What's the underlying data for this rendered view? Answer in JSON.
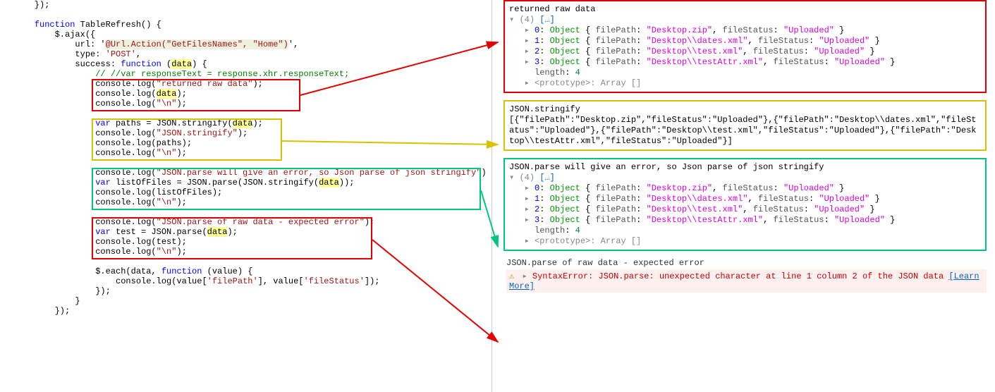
{
  "left": {
    "l01": "    });",
    "l02": "",
    "l03_a": "    ",
    "l03_fn": "function",
    "l03_b": " TableRefresh() {",
    "l04": "        $.ajax({",
    "l05_a": "            url: '",
    "l05_url": "@Url.Action(\"GetFilesNames\", \"Home\")",
    "l05_b": "',",
    "l06_a": "            type: ",
    "l06_post": "'POST'",
    "l06_b": ",",
    "l07_a": "            success: ",
    "l07_fn": "function",
    "l07_b": " (",
    "l07_data": "data",
    "l07_c": ") {",
    "l08": "                // //var responseText = response.xhr.responseText;",
    "l09_a": "                console.log(",
    "l09_s": "\"returned raw data\"",
    "l09_b": ");",
    "l10_a": "                console.log(",
    "l10_d": "data",
    "l10_b": ");",
    "l11_a": "                console.log(",
    "l11_s": "\"\\n\"",
    "l11_b": ");",
    "l12": "",
    "l13_a": "                ",
    "l13_var": "var",
    "l13_b": " paths = JSON.stringify(",
    "l13_d": "data",
    "l13_c": ");",
    "l14_a": "                console.log(",
    "l14_s": "\"JSON.stringify\"",
    "l14_b": ");",
    "l15": "                console.log(paths);",
    "l16_a": "                console.log(",
    "l16_s": "\"\\n\"",
    "l16_b": ");",
    "l17": "",
    "l18_a": "                console.log(",
    "l18_s": "\"JSON.parse will give an error, so Json parse of json stringify\"",
    "l18_b": ")",
    "l19_a": "                ",
    "l19_var": "var",
    "l19_b": " listOfFiles = JSON.parse(JSON.stringify(",
    "l19_d": "data",
    "l19_c": "));",
    "l20": "                console.log(listOfFiles);",
    "l21_a": "                console.log(",
    "l21_s": "\"\\n\"",
    "l21_b": ");",
    "l22": "",
    "l23_a": "                console.log(",
    "l23_s": "\"JSON.parse of raw data - expected error\"",
    "l23_b": ");",
    "l24_a": "                ",
    "l24_var": "var",
    "l24_b": " test = JSON.parse(",
    "l24_d": "data",
    "l24_c": ");",
    "l25": "                console.log(test);",
    "l26_a": "                console.log(",
    "l26_s": "\"\\n\"",
    "l26_b": ");",
    "l27": "",
    "l28_a": "                $.each(data, ",
    "l28_fn": "function",
    "l28_b": " (value) {",
    "l29_a": "                    console.log(value[",
    "l29_s1": "'filePath'",
    "l29_b": "], value[",
    "l29_s2": "'fileStatus'",
    "l29_c": "]);",
    "l30": "                });",
    "l31": "            }",
    "l32": "        });"
  },
  "right": {
    "p1_title": "returned raw data",
    "arr_count": "(4)",
    "arr_ellipsis": "[…]",
    "item0_idx": "0",
    "item0_obj": "Object",
    "item0_fp": "filePath",
    "item0_fpv": "\"Desktop.zip\"",
    "item0_fs": "fileStatus",
    "item0_fsv": "\"Uploaded\"",
    "item1_idx": "1",
    "item1_obj": "Object",
    "item1_fp": "filePath",
    "item1_fpv": "\"Desktop\\\\dates.xml\"",
    "item1_fs": "fileStatus",
    "item1_fsv": "\"Uploaded\"",
    "item2_idx": "2",
    "item2_obj": "Object",
    "item2_fp": "filePath",
    "item2_fpv": "\"Desktop\\\\test.xml\"",
    "item2_fs": "fileStatus",
    "item2_fsv": "\"Uploaded\"",
    "item3_idx": "3",
    "item3_obj": "Object",
    "item3_fp": "filePath",
    "item3_fpv": "\"Desktop\\\\testAttr.xml\"",
    "item3_fs": "fileStatus",
    "item3_fsv": "\"Uploaded\"",
    "length_label": "length",
    "length_val": "4",
    "proto": "<prototype>: Array []",
    "p2_title": "JSON.stringify",
    "p2_body": "[{\"filePath\":\"Desktop.zip\",\"fileStatus\":\"Uploaded\"},{\"filePath\":\"Desktop\\\\dates.xml\",\"fileStatus\":\"Uploaded\"},{\"filePath\":\"Desktop\\\\test.xml\",\"fileStatus\":\"Uploaded\"},{\"filePath\":\"Desktop\\\\testAttr.xml\",\"fileStatus\":\"Uploaded\"}]",
    "p3_title": "JSON.parse will give an error, so Json parse of json stringify",
    "p4_label": "JSON.parse of raw data - expected error",
    "err": "SyntaxError: JSON.parse: unexpected character at line 1 column 2 of the JSON data",
    "learn": "[Learn More]"
  }
}
